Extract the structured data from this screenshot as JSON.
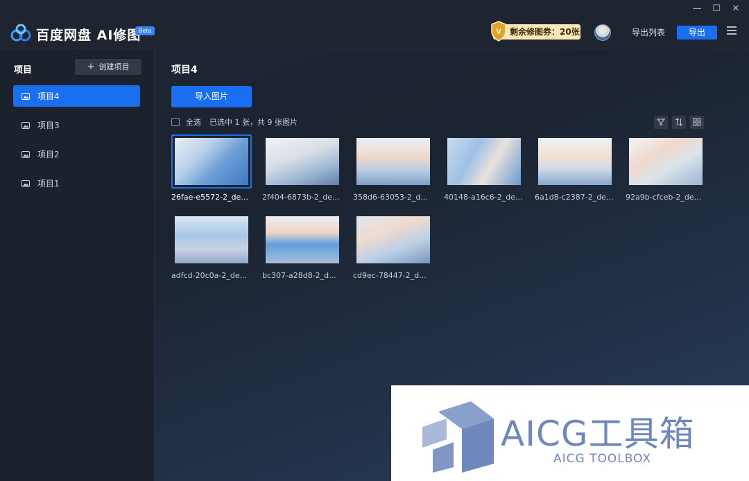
{
  "titlebar": {
    "app_title": "百度网盘 AI修图",
    "beta": "Beta",
    "quota_label": "剩余修图券：20张",
    "export_list": "导出列表",
    "export": "导出",
    "minimize": "—",
    "maximize": "☐",
    "close": "✕"
  },
  "sidebar": {
    "title": "项目",
    "create_label": "创建项目",
    "items": [
      {
        "label": "项目4",
        "active": true
      },
      {
        "label": "项目3",
        "active": false
      },
      {
        "label": "项目2",
        "active": false
      },
      {
        "label": "项目1",
        "active": false
      }
    ]
  },
  "main": {
    "title": "项目4",
    "import_label": "导入图片",
    "select_all": "全选",
    "selection_status": "已选中 1 张，共 9 张图片",
    "images": [
      {
        "name": "26fae-e5572-2_de...",
        "selected": true
      },
      {
        "name": "2f404-6873b-2_de..."
      },
      {
        "name": "358d6-63053-2_d..."
      },
      {
        "name": "40148-a16c6-2_de..."
      },
      {
        "name": "6a1d8-c2387-2_de..."
      },
      {
        "name": "92a9b-cfceb-2_de..."
      },
      {
        "name": "adfcd-20c0a-2_de..."
      },
      {
        "name": "bc307-a28d8-2_d..."
      },
      {
        "name": "cd9ec-78447-2_d..."
      }
    ]
  },
  "watermark": {
    "title": "AICG工具箱",
    "subtitle": "AICG TOOLBOX"
  },
  "colors": {
    "accent": "#1a6ef0",
    "quota_bg": "#fbe7b6",
    "watermark": "#6e87bd"
  }
}
